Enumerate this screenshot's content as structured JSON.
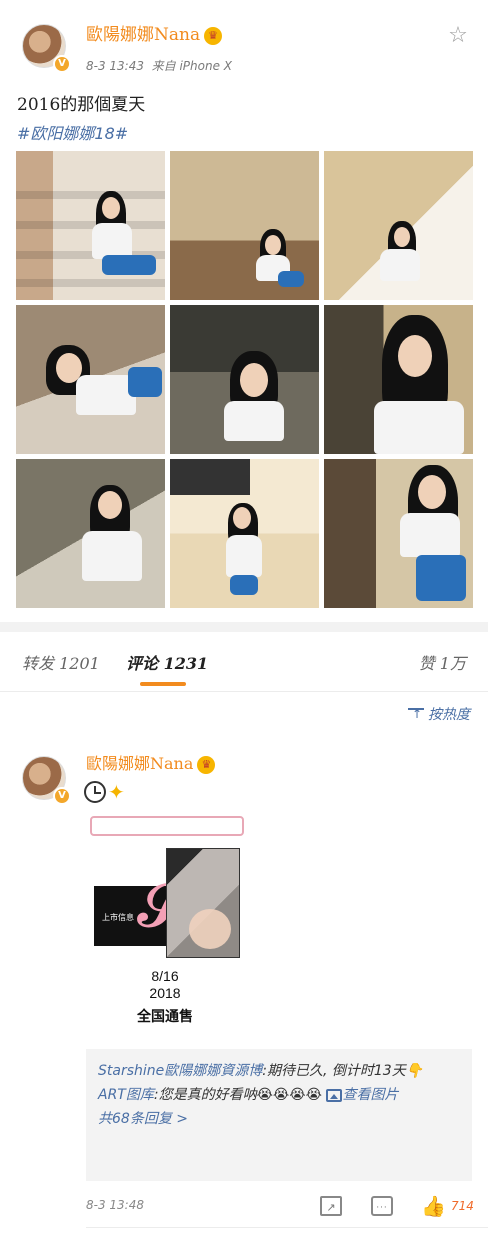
{
  "post": {
    "username": "歐陽娜娜Nana",
    "timestamp": "8-3 13:43",
    "source": "来自 iPhone X",
    "text": "2016的那個夏天",
    "hashtag": "#欧阳娜娜18#",
    "photos": [
      {
        "icon": "photo"
      },
      {
        "icon": "photo"
      },
      {
        "icon": "photo"
      },
      {
        "icon": "photo"
      },
      {
        "icon": "photo"
      },
      {
        "icon": "photo"
      },
      {
        "icon": "photo"
      },
      {
        "icon": "photo"
      },
      {
        "icon": "photo"
      }
    ]
  },
  "tabs": {
    "repost": "转发 1201",
    "comments": "评论 1231",
    "likes": "赞 1万"
  },
  "sort": {
    "label": "按热度"
  },
  "comment": {
    "username": "歐陽娜娜Nana",
    "promo": {
      "date_md": "8/16",
      "date_year": "2018",
      "sale": "全国通售",
      "box_text": "上市信息"
    },
    "replies": [
      {
        "name": "Starshine歐陽娜娜資源博",
        "text": ":期待已久, 倒计时13天👇"
      },
      {
        "name": "ART图库",
        "text": ":您是真的好看呐😭😭😭😭"
      }
    ],
    "view_image": "查看图片",
    "more_replies": "共68条回复 >",
    "timestamp": "8-3 13:48",
    "like_count": "714"
  },
  "colors": {
    "accent": "#f28b1e",
    "link": "#4a6fa5",
    "like": "#f06a2a"
  }
}
